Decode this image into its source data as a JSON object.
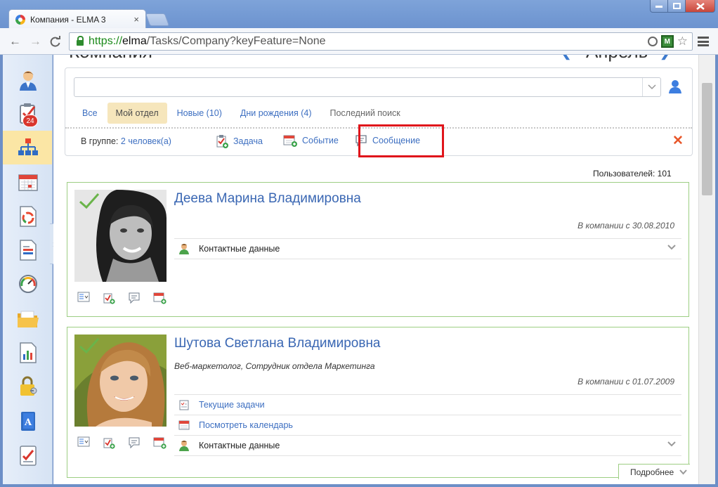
{
  "browser": {
    "tab_title": "Компания - ELMA 3",
    "tab_close": "×",
    "url_scheme": "https://",
    "url_host": "elma",
    "url_path": "/Tasks/Company?keyFeature=None",
    "ext_label": "M",
    "back": "←",
    "forward": "→",
    "reload": "C"
  },
  "sidebar": {
    "tasks_badge": "24",
    "handle": "›"
  },
  "header_partial": {
    "title": "Компания",
    "month": "Апрель",
    "prev": "❮",
    "next": "❯"
  },
  "filters": {
    "dropdown_icon": "⌄",
    "tabs": [
      "Все",
      "Мой отдел",
      "Новые (10)",
      "Дни рождения (4)",
      "Последний поиск"
    ],
    "active_tab": "Мой отдел",
    "group_label": "В группе:",
    "group_link": "2 человек(а)",
    "actions": {
      "task": "Задача",
      "event": "Событие",
      "message": "Сообщение"
    },
    "clear": "✕"
  },
  "users_count_label": "Пользователей: 101",
  "cards": [
    {
      "name": "Деева Марина Владимировна",
      "position": "",
      "since": "В компании с 30.08.2010",
      "contact_label": "Контактные данные"
    },
    {
      "name": "Шутова Светлана Владимировна",
      "position": "Веб-маркетолог, Сотрудник отдела Маркетинга",
      "since": "В компании с 01.07.2009",
      "current_tasks": "Текущие задачи",
      "view_calendar": "Посмотреть календарь",
      "contact_label": "Контактные данные",
      "more": "Подробнее"
    }
  ],
  "colors": {
    "link": "#3d6fc1",
    "card_border": "#9dce83",
    "active_tab_bg": "#f6e6bc",
    "highlight": "#e0151b",
    "sidebar_active": "#fbe6a5"
  }
}
